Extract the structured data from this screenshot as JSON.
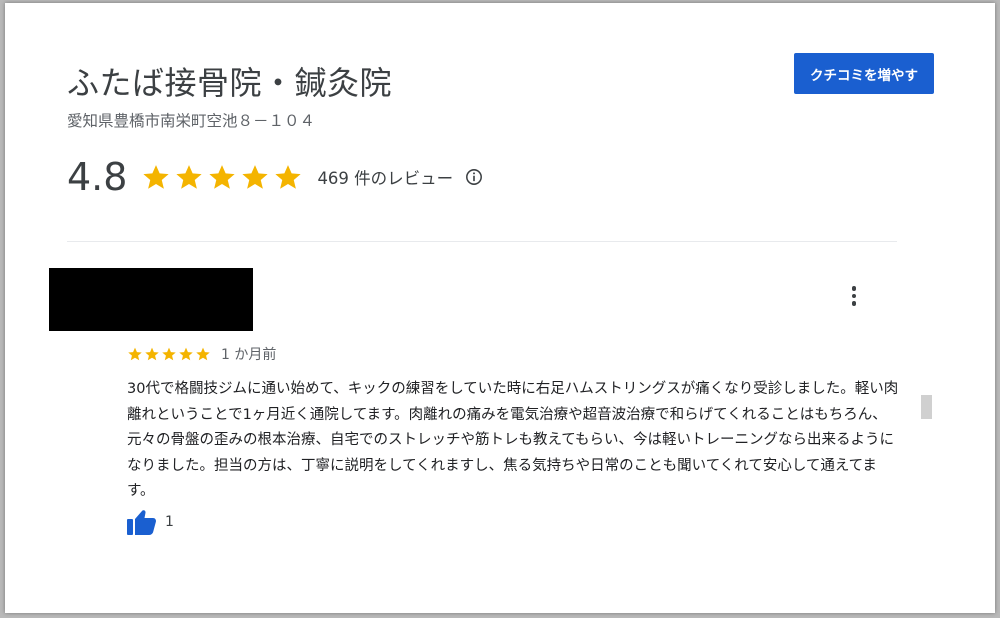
{
  "business": {
    "name": "ふたば接骨院・鍼灸院",
    "address": "愛知県豊橋市南栄町空池８－１０４"
  },
  "cta": {
    "label": "クチコミを増やす"
  },
  "rating": {
    "value": "4.8",
    "stars": 5,
    "review_count_label": "469 件のレビュー",
    "star_color": "#f4b400"
  },
  "review": {
    "stars": 5,
    "time": "1 か月前",
    "text": "30代で格闘技ジムに通い始めて、キックの練習をしていた時に右足ハムストリングスが痛くなり受診しました。軽い肉離れということで1ヶ月近く通院してます。肉離れの痛みを電気治療や超音波治療で和らげてくれることはもちろん、元々の骨盤の歪みの根本治療、自宅でのストレッチや筋トレも教えてもらい、今は軽いトレーニングなら出来るようになりました。担当の方は、丁寧に説明をしてくれますし、焦る気持ちや日常のことも聞いてくれて安心して通えてます。",
    "likes": "1"
  },
  "colors": {
    "primary": "#1a5fd0",
    "text": "#202124",
    "muted": "#5f6368"
  }
}
